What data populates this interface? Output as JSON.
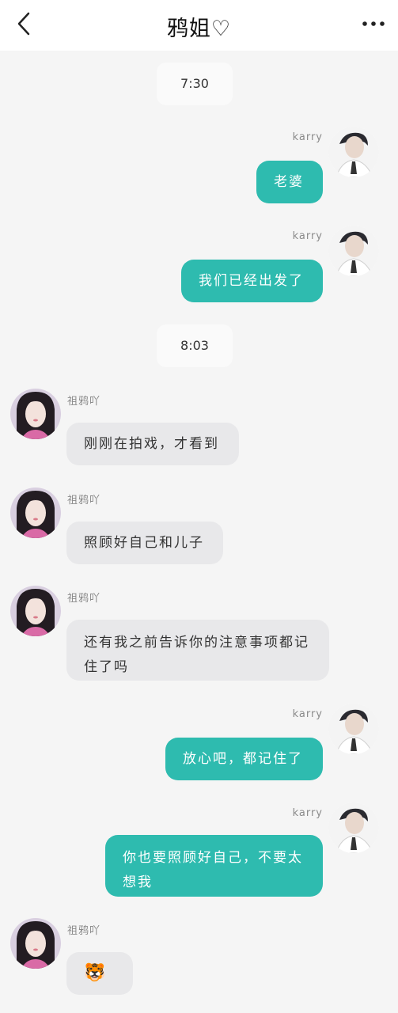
{
  "header": {
    "title": "鸦姐♡"
  },
  "timestamps": [
    "7:30",
    "8:03"
  ],
  "names": {
    "me": "karry",
    "her": "祖鸦吖"
  },
  "messages": [
    {
      "side": "out",
      "text": "老婆"
    },
    {
      "side": "out",
      "text": "我们已经出发了"
    },
    {
      "side": "in",
      "text": "刚刚在拍戏，才看到"
    },
    {
      "side": "in",
      "text": "照顾好自己和儿子"
    },
    {
      "side": "in",
      "text": "还有我之前告诉你的注意事项都记住了吗"
    },
    {
      "side": "out",
      "text": "放心吧，都记住了"
    },
    {
      "side": "out",
      "text": "你也要照顾好自己，不要太想我"
    },
    {
      "side": "in",
      "text": "🐯",
      "type": "sticker"
    }
  ],
  "icons": {
    "back": "chevron-left-icon",
    "more": "more-dots-icon",
    "sticker": "tiger-face-emoji"
  },
  "colors": {
    "outgoing_bubble": "#2ebbaf",
    "incoming_bubble": "#e8e8ea",
    "background": "#f5f5f5",
    "header": "#ffffff"
  }
}
